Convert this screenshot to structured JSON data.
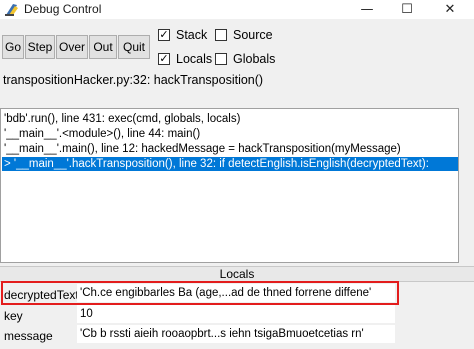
{
  "window": {
    "title": "Debug Control",
    "minimize_glyph": "—",
    "maximize_glyph": "☐",
    "close_glyph": "✕"
  },
  "toolbar": {
    "go_label": "Go",
    "step_label": "Step",
    "over_label": "Over",
    "out_label": "Out",
    "quit_label": "Quit"
  },
  "options": {
    "stack": {
      "label": "Stack",
      "checked": true
    },
    "source": {
      "label": "Source",
      "checked": false
    },
    "locals": {
      "label": "Locals",
      "checked": true
    },
    "globals": {
      "label": "Globals",
      "checked": false
    }
  },
  "location": "transpositionHacker.py:32: hackTransposition()",
  "stack": [
    "'bdb'.run(), line 431: exec(cmd, globals, locals)",
    "'__main__'.<module>(), line 44: main()",
    "'__main__'.main(), line 12: hackedMessage = hackTransposition(myMessage)",
    "> '__main__'.hackTransposition(), line 32: if detectEnglish.isEnglish(decryptedText):"
  ],
  "locals_header": "Locals",
  "locals": [
    {
      "name": "decryptedText",
      "value": "'Ch.ce engibbarles Ba (age,...ad de thned forrene diffene'"
    },
    {
      "name": "key",
      "value": "10"
    },
    {
      "name": "message",
      "value": "'Cb b rssti aieih rooaopbrt...s iehn tsigaBmuoetcetias rn'"
    }
  ],
  "colors": {
    "selection": "#0078d7",
    "highlight_border": "#e31c1c"
  },
  "icons": {
    "app": "python-feather-icon",
    "check": "✓"
  }
}
